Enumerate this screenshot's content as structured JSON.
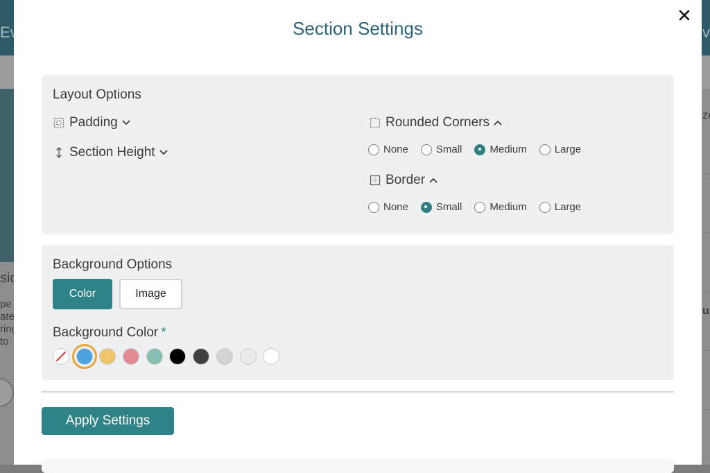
{
  "background": {
    "left_fragments": [
      "Ev",
      "sic",
      "pe",
      "ate",
      "ring",
      "to"
    ],
    "right_fragments": [
      "ve",
      "ze",
      "up"
    ]
  },
  "modal": {
    "title": "Section Settings",
    "close_icon": "close-icon"
  },
  "layout_options": {
    "heading": "Layout Options",
    "padding_label": "Padding",
    "section_height_label": "Section Height",
    "rounded_corners": {
      "label": "Rounded Corners",
      "options": [
        "None",
        "Small",
        "Medium",
        "Large"
      ],
      "selected": "Medium"
    },
    "border": {
      "label": "Border",
      "options": [
        "None",
        "Small",
        "Medium",
        "Large"
      ],
      "selected": "Small"
    }
  },
  "background_options": {
    "heading": "Background Options",
    "color_button": "Color",
    "image_button": "Image",
    "active_tab": "Color",
    "bg_color_label": "Background Color",
    "required_mark": "*",
    "swatches": [
      {
        "name": "none",
        "color": "#ffffff"
      },
      {
        "name": "blue",
        "color": "#4aa3df"
      },
      {
        "name": "yellow",
        "color": "#efc56b"
      },
      {
        "name": "pink",
        "color": "#e08a92"
      },
      {
        "name": "teal",
        "color": "#86bfb1"
      },
      {
        "name": "black",
        "color": "#000000"
      },
      {
        "name": "dark-gray",
        "color": "#3f4042"
      },
      {
        "name": "light-gray",
        "color": "#d3d4d6"
      },
      {
        "name": "lighter-gray",
        "color": "#e9eaec"
      },
      {
        "name": "white",
        "color": "#ffffff"
      }
    ],
    "selected_swatch": "blue"
  },
  "apply_button": "Apply Settings",
  "colors": {
    "accent": "#2f8285",
    "title": "#2b6478",
    "selection_ring": "#e8a43a"
  }
}
